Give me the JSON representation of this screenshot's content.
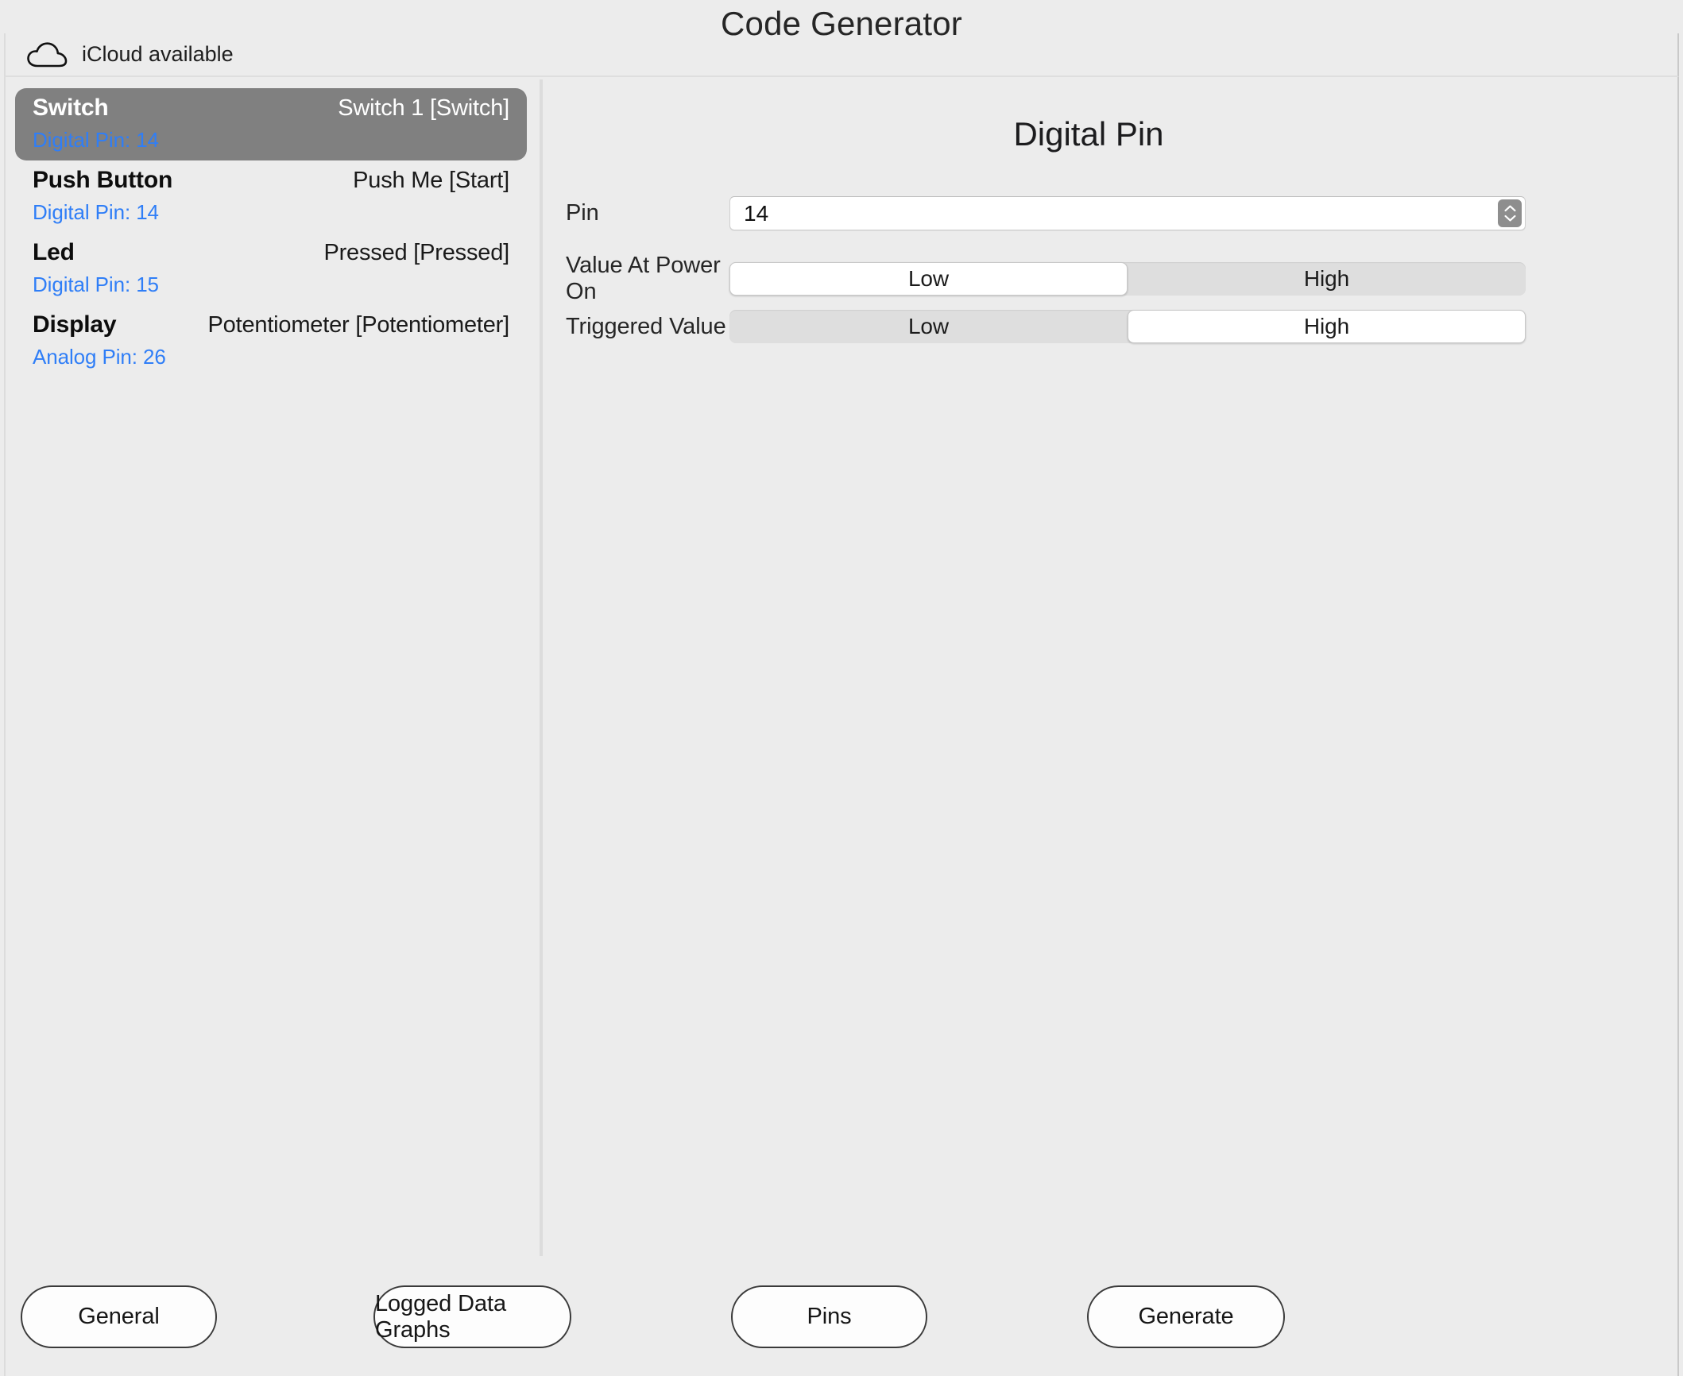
{
  "window": {
    "title": "Code Generator"
  },
  "status_bar": {
    "icon": "cloud-icon",
    "text": "iCloud available"
  },
  "sidebar": {
    "items": [
      {
        "type": "Switch",
        "name": "Switch 1 [Switch]",
        "pin": "Digital Pin: 14",
        "selected": true
      },
      {
        "type": "Push Button",
        "name": "Push Me [Start]",
        "pin": "Digital Pin: 14",
        "selected": false
      },
      {
        "type": "Led",
        "name": "Pressed [Pressed]",
        "pin": "Digital Pin: 15",
        "selected": false
      },
      {
        "type": "Display",
        "name": "Potentiometer [Potentiometer]",
        "pin": "Analog Pin: 26",
        "selected": false
      }
    ],
    "selection_color": "#808080",
    "pin_color": "#2f7ef7"
  },
  "detail": {
    "title": "Digital Pin",
    "pin_row": {
      "label": "Pin",
      "value": "14"
    },
    "power_on_row": {
      "label": "Value At Power On",
      "options": [
        "Low",
        "High"
      ],
      "selected": "Low"
    },
    "triggered_row": {
      "label": "Triggered Value",
      "options": [
        "Low",
        "High"
      ],
      "selected": "High"
    }
  },
  "toolbar": {
    "general_label": "General",
    "graphs_label": "Logged Data Graphs",
    "pins_label": "Pins",
    "generate_label": "Generate"
  }
}
